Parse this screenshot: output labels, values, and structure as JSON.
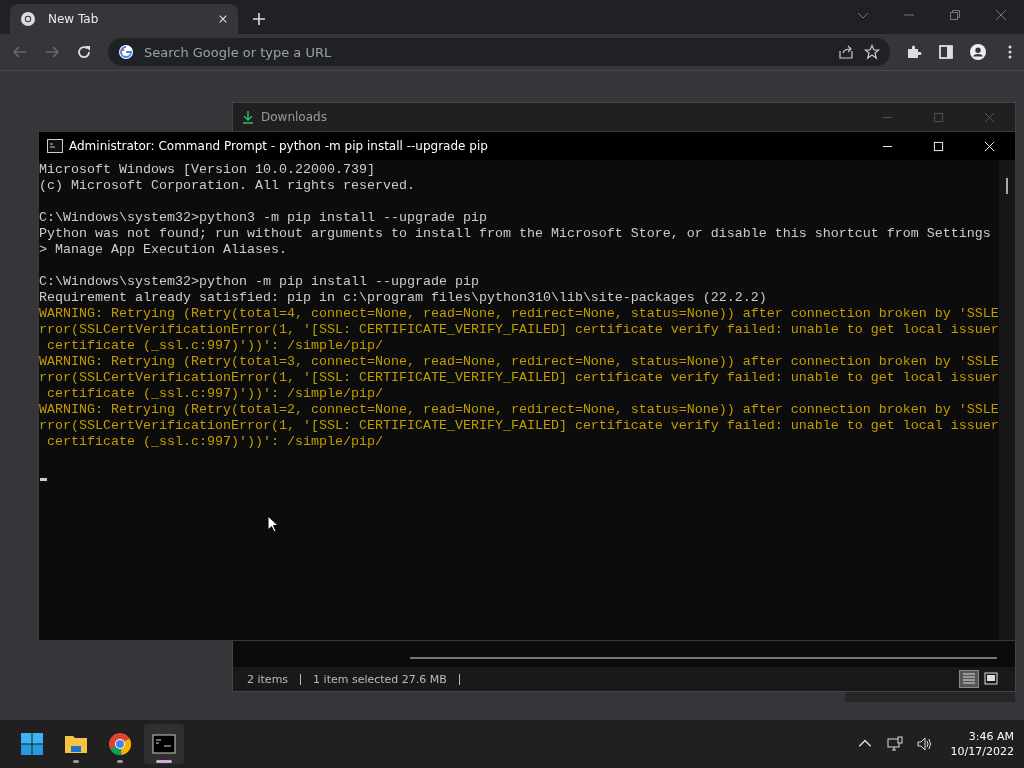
{
  "browser": {
    "tabs": [
      {
        "title": "New Tab",
        "selected": true
      }
    ],
    "omnibox": {
      "placeholder": "Search Google or type a URL"
    },
    "nav": {
      "back_disabled": true,
      "forward_disabled": true
    }
  },
  "downloads": {
    "title": "Downloads",
    "status": [
      "2 items",
      "1 item selected  27.6 MB"
    ],
    "views": [
      {
        "kind": "details",
        "selected": true
      },
      {
        "kind": "preview",
        "selected": false
      }
    ]
  },
  "terminal": {
    "title": "Administrator: Command Prompt - python  -m pip install --upgrade pip",
    "lines": [
      {
        "kind": "normal",
        "text": "Microsoft Windows [Version 10.0.22000.739]"
      },
      {
        "kind": "normal",
        "text": "(c) Microsoft Corporation. All rights reserved."
      },
      {
        "kind": "blank"
      },
      {
        "kind": "normal",
        "text": "C:\\Windows\\system32>python3 -m pip install --upgrade pip"
      },
      {
        "kind": "normal",
        "text": "Python was not found; run without arguments to install from the Microsoft Store, or disable this shortcut from Settings"
      },
      {
        "kind": "normal",
        "text": "> Manage App Execution Aliases."
      },
      {
        "kind": "blank"
      },
      {
        "kind": "normal",
        "text": "C:\\Windows\\system32>python -m pip install --upgrade pip"
      },
      {
        "kind": "normal",
        "text": "Requirement already satisfied: pip in c:\\program files\\python310\\lib\\site-packages (22.2.2)"
      },
      {
        "kind": "warning",
        "text": "WARNING: Retrying (Retry(total=4, connect=None, read=None, redirect=None, status=None)) after connection broken by 'SSLE"
      },
      {
        "kind": "warning",
        "text": "rror(SSLCertVerificationError(1, '[SSL: CERTIFICATE_VERIFY_FAILED] certificate verify failed: unable to get local issuer"
      },
      {
        "kind": "warning",
        "text": " certificate (_ssl.c:997)'))': /simple/pip/"
      },
      {
        "kind": "warning",
        "text": "WARNING: Retrying (Retry(total=3, connect=None, read=None, redirect=None, status=None)) after connection broken by 'SSLE"
      },
      {
        "kind": "warning",
        "text": "rror(SSLCertVerificationError(1, '[SSL: CERTIFICATE_VERIFY_FAILED] certificate verify failed: unable to get local issuer"
      },
      {
        "kind": "warning",
        "text": " certificate (_ssl.c:997)'))': /simple/pip/"
      },
      {
        "kind": "warning",
        "text": "WARNING: Retrying (Retry(total=2, connect=None, read=None, redirect=None, status=None)) after connection broken by 'SSLE"
      },
      {
        "kind": "warning",
        "text": "rror(SSLCertVerificationError(1, '[SSL: CERTIFICATE_VERIFY_FAILED] certificate verify failed: unable to get local issuer"
      },
      {
        "kind": "warning",
        "text": " certificate (_ssl.c:997)'))': /simple/pip/"
      },
      {
        "kind": "blank"
      },
      {
        "kind": "cursor"
      }
    ]
  },
  "taskbar": {
    "apps": [
      {
        "kind": "start",
        "selected": false,
        "running": false
      },
      {
        "kind": "files",
        "selected": false,
        "running": true
      },
      {
        "kind": "chrome",
        "selected": false,
        "running": true
      },
      {
        "kind": "terminal",
        "selected": true,
        "running": true
      }
    ],
    "time": "3:46 AM",
    "date": "10/17/2022"
  }
}
